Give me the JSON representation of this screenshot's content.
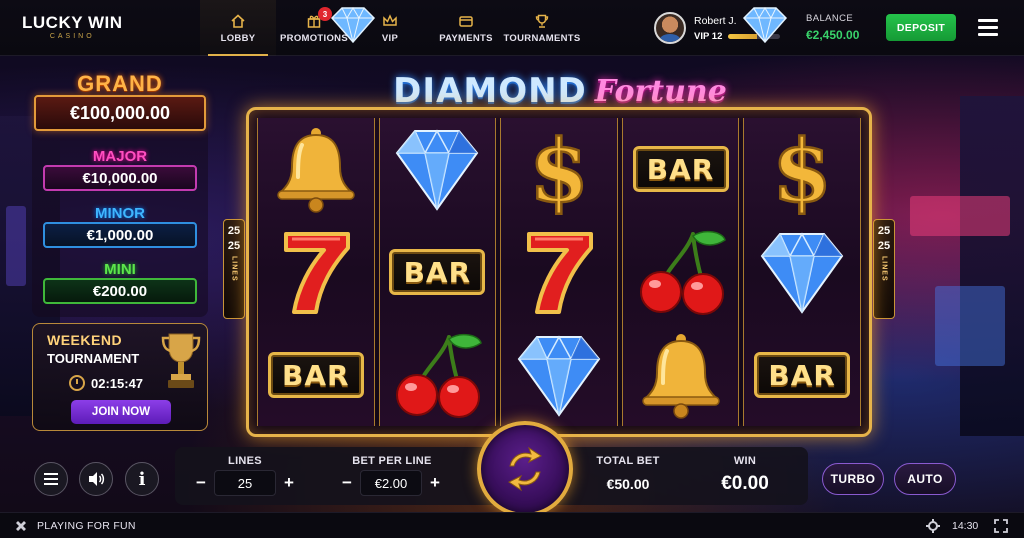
{
  "brand": {
    "name": "LUCKY WIN",
    "tagline": "CASINO"
  },
  "nav": [
    {
      "label": "LOBBY",
      "icon": "home-icon",
      "active": true
    },
    {
      "label": "PROMOTIONS",
      "icon": "gift-icon",
      "badge": "3"
    },
    {
      "label": "VIP",
      "icon": "crown-icon"
    },
    {
      "label": "PAYMENTS",
      "icon": "wallet-icon"
    },
    {
      "label": "TOURNAMENTS",
      "icon": "trophy-icon"
    }
  ],
  "user": {
    "name": "Robert J.",
    "vip": "VIP 12",
    "vip_progress": 0.55
  },
  "balance": {
    "label": "BALANCE",
    "value": "€2,450.00"
  },
  "deposit_label": "DEPOSIT",
  "jackpots": {
    "grand": {
      "name": "GRAND",
      "value": "€100,000.00"
    },
    "major": {
      "name": "MAJOR",
      "value": "€10,000.00"
    },
    "minor": {
      "name": "MINOR",
      "value": "€1,000.00"
    },
    "mini": {
      "name": "MINI",
      "value": "€200.00"
    }
  },
  "tournament": {
    "line1": "WEEKEND",
    "line2": "TOURNAMENT",
    "timer": "02:15:47",
    "join_label": "JOIN NOW"
  },
  "game_title": {
    "part1": "DIAMOND",
    "part2": "Fortune"
  },
  "side_lines": {
    "top": "25",
    "middle": "25",
    "word": "LINES"
  },
  "reels": [
    [
      "bell",
      "seven",
      "bar"
    ],
    [
      "diamond",
      "bar",
      "cherry"
    ],
    [
      "dollar",
      "seven",
      "diamond"
    ],
    [
      "bar",
      "cherry",
      "bell"
    ],
    [
      "dollar",
      "diamond",
      "bar"
    ]
  ],
  "bar_text": "BAR",
  "controls": {
    "lines": {
      "label": "LINES",
      "value": "25"
    },
    "bet_per_line": {
      "label": "BET PER LINE",
      "value": "€2.00"
    },
    "total_bet": {
      "label": "TOTAL BET",
      "value": "€50.00"
    },
    "win": {
      "label": "WIN",
      "value": "€0.00"
    },
    "minus": "−",
    "plus": "+",
    "turbo_label": "TURBO",
    "auto_label": "AUTO",
    "info_glyph": "i"
  },
  "footer": {
    "mode": "PLAYING FOR FUN",
    "time": "14:30"
  },
  "colors": {
    "accent_gold": "#e6b34a",
    "deposit_green": "#25c34b",
    "balance_green": "#39d36b"
  }
}
